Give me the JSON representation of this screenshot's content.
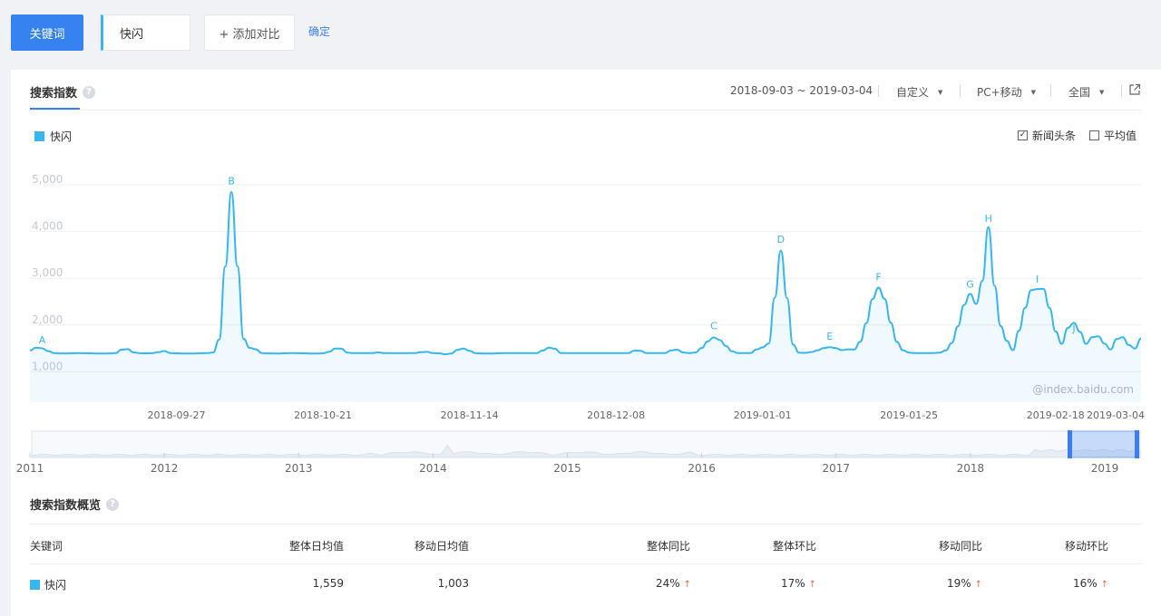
{
  "toolbar": {
    "keyword_tab": "关键词",
    "keyword_value": "快闪",
    "add_compare": "+ 添加对比",
    "confirm": "确定"
  },
  "index_panel": {
    "title": "搜索指数",
    "help": "?",
    "date_range": "2018-09-03 ~ 2019-03-04",
    "custom": "自定义",
    "device": "PC+移动",
    "region": "全国",
    "legend": "快闪",
    "news_checkbox": "新闻头条",
    "news_checked": "✓",
    "avg_checkbox": "平均值",
    "watermark": "@index.baidu.com"
  },
  "chart_data": {
    "type": "line",
    "series": [
      {
        "name": "快闪",
        "color": "#38b6f0"
      }
    ],
    "y_ticks": [
      "1,000",
      "2,000",
      "3,000",
      "4,000",
      "5,000"
    ],
    "ylim": [
      0,
      5000
    ],
    "x_ticks": [
      "2018-09-27",
      "2018-10-21",
      "2018-11-14",
      "2018-12-08",
      "2019-01-01",
      "2019-01-25",
      "2019-02-18",
      "2019-03-04"
    ],
    "x_range": [
      "2018-09-03",
      "2019-03-04"
    ],
    "annotations": [
      {
        "label": "A",
        "date": "2018-09-05",
        "value": 1450
      },
      {
        "label": "B",
        "date": "2018-10-06",
        "value": 4850
      },
      {
        "label": "C",
        "date": "2018-12-24",
        "value": 1750
      },
      {
        "label": "D",
        "date": "2019-01-04",
        "value": 3600
      },
      {
        "label": "E",
        "date": "2019-01-12",
        "value": 1530
      },
      {
        "label": "F",
        "date": "2019-01-20",
        "value": 2800
      },
      {
        "label": "G",
        "date": "2019-02-04",
        "value": 2650
      },
      {
        "label": "H",
        "date": "2019-02-07",
        "value": 4050
      },
      {
        "label": "I",
        "date": "2019-02-15",
        "value": 2750
      },
      {
        "label": "J",
        "date": "2019-02-21",
        "value": 1700
      }
    ],
    "grid": true
  },
  "brush": {
    "year_ticks": [
      "2011",
      "2012",
      "2013",
      "2014",
      "2015",
      "2016",
      "2017",
      "2018",
      "2019"
    ]
  },
  "overview": {
    "title": "搜索指数概览",
    "help": "?",
    "headers": {
      "keyword": "关键词",
      "overall_avg": "整体日均值",
      "mobile_avg": "移动日均值",
      "overall_yoy": "整体同比",
      "overall_mom": "整体环比",
      "mobile_yoy": "移动同比",
      "mobile_mom": "移动环比"
    },
    "row": {
      "keyword": "快闪",
      "overall_avg": "1,559",
      "mobile_avg": "1,003",
      "overall_yoy": "24%",
      "overall_mom": "17%",
      "mobile_yoy": "19%",
      "mobile_mom": "16%",
      "arrow": "↑"
    }
  }
}
